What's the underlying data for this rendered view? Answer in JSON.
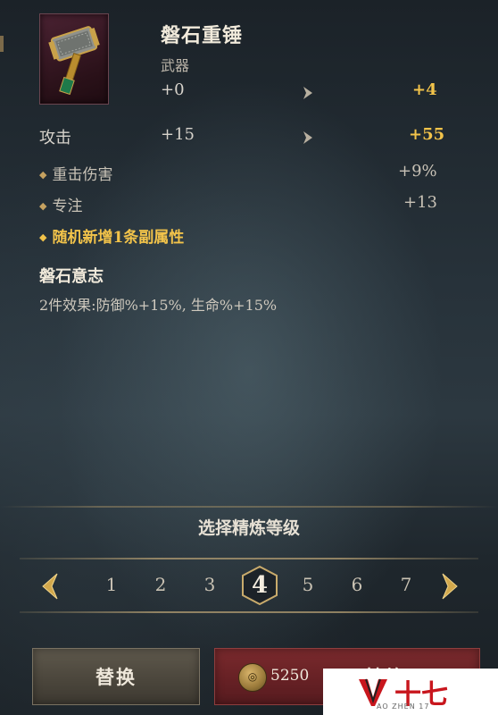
{
  "item": {
    "name": "磐石重锤",
    "type": "武器",
    "icon": "hammer-icon"
  },
  "level_compare": {
    "current": "+0",
    "next": "+4"
  },
  "main_stat": {
    "label": "攻击",
    "current": "+15",
    "next": "+55"
  },
  "sub_stats": [
    {
      "label": "重击伤害",
      "value": "+9%"
    },
    {
      "label": "专注",
      "value": "+13"
    }
  ],
  "random_note": "随机新增1条副属性",
  "set_bonus": {
    "title": "磐石意志",
    "description": "2件效果:防御%+15%, 生命%+15%"
  },
  "refine": {
    "prompt": "选择精炼等级",
    "levels": [
      "1",
      "2",
      "3",
      "4",
      "5",
      "6",
      "7"
    ],
    "selected": "4"
  },
  "buttons": {
    "replace": "替换",
    "refine": "精炼",
    "cost": "5250"
  },
  "watermark": {
    "text": "十七",
    "sub": "AO ZHEN 17"
  },
  "colors": {
    "gold": "#f2c34a",
    "refine_button": "#6a2226",
    "replace_button": "#4d483e"
  }
}
